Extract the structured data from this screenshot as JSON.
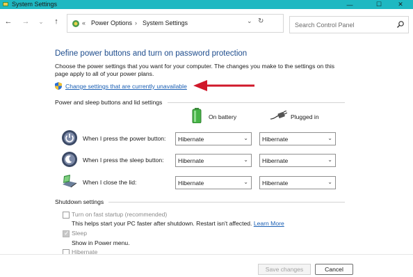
{
  "window": {
    "title": "System Settings",
    "controls": {
      "minimize": "—",
      "maximize": "☐",
      "close": "✕"
    }
  },
  "nav": {
    "back_icon": "←",
    "forward_icon": "→",
    "recent_icon": "⌄",
    "up_icon": "↑"
  },
  "address": {
    "separator_start": "«",
    "crumbs": [
      "Power Options",
      "System Settings"
    ],
    "separator": "›",
    "dropdown_icon": "⌄",
    "refresh_icon": "↻"
  },
  "search": {
    "placeholder": "Search Control Panel"
  },
  "main": {
    "heading": "Define power buttons and turn on password protection",
    "description": "Choose the power settings that you want for your computer. The changes you make to the settings on this page apply to all of your power plans.",
    "change_link": "Change settings that are currently unavailable"
  },
  "power_section": {
    "title": "Power and sleep buttons and lid settings",
    "col_battery": "On battery",
    "col_plugged": "Plugged in",
    "rows": [
      {
        "label": "When I press the power button:",
        "battery": "Hibernate",
        "plugged": "Hibernate"
      },
      {
        "label": "When I press the sleep button:",
        "battery": "Hibernate",
        "plugged": "Hibernate"
      },
      {
        "label": "When I close the lid:",
        "battery": "Hibernate",
        "plugged": "Hibernate"
      }
    ],
    "chevron": "⌄"
  },
  "shutdown_section": {
    "title": "Shutdown settings",
    "fast_startup": {
      "label": "Turn on fast startup (recommended)",
      "note": "This helps start your PC faster after shutdown. Restart isn't affected.",
      "link": "Learn More",
      "checked": false
    },
    "sleep": {
      "label": "Sleep",
      "note": "Show in Power menu.",
      "checked": true
    },
    "hibernate": {
      "label": "Hibernate",
      "checked": false
    }
  },
  "footer": {
    "save": "Save changes",
    "cancel": "Cancel"
  },
  "colors": {
    "titlebar": "#1fb8c2",
    "heading": "#1c4b8c",
    "link": "#1a5fb4",
    "arrow": "#d0182a"
  }
}
